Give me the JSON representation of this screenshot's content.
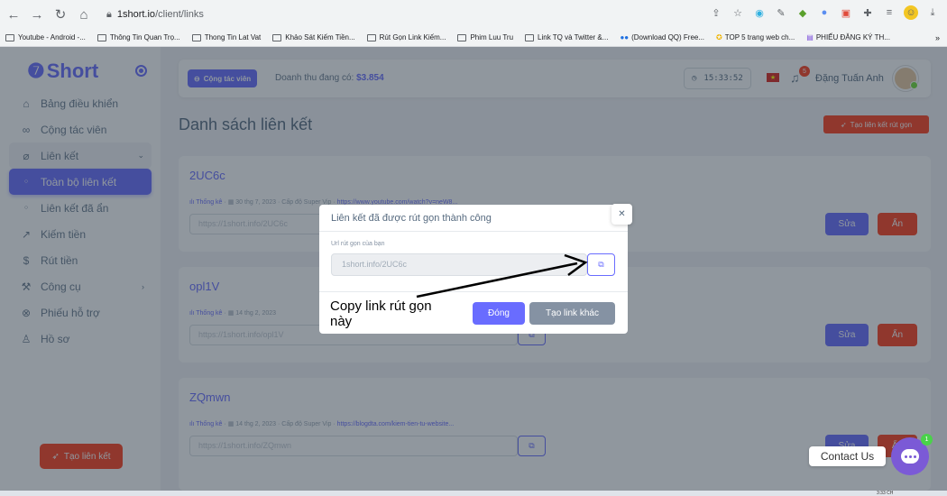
{
  "browser": {
    "url_host": "1short.io",
    "url_path": "/client/links",
    "bookmarks": [
      "Youtube - Android -...",
      "Thông Tin Quan Trọ...",
      "Thong Tin Lat Vat",
      "Khảo Sát Kiếm Tiền...",
      "Rút Gọn Link Kiếm...",
      "Phim Luu Tru",
      "Link TQ và Twitter &...",
      "(Download QQ) Free...",
      "TOP 5 trang web ch...",
      "PHIẾU ĐĂNG KÝ TH..."
    ],
    "more": "»"
  },
  "sidebar": {
    "logo": "Short",
    "items": [
      {
        "label": "Bảng điều khiển",
        "icon": "home-icon",
        "glyph": "⌂"
      },
      {
        "label": "Cộng tác viên",
        "icon": "link-icon",
        "glyph": "∞"
      },
      {
        "label": "Liên kết",
        "icon": "chain-icon",
        "glyph": "⌀"
      },
      {
        "label": "Toàn bộ liên kết",
        "icon": "dot-icon",
        "glyph": "○"
      },
      {
        "label": "Liên kết đã ẩn",
        "icon": "dot-icon",
        "glyph": "○"
      },
      {
        "label": "Kiếm tiền",
        "icon": "trend-icon",
        "glyph": "↗"
      },
      {
        "label": "Rút tiền",
        "icon": "dollar-icon",
        "glyph": "$"
      },
      {
        "label": "Công cụ",
        "icon": "tool-icon",
        "glyph": "⚒"
      },
      {
        "label": "Phiếu hỗ trợ",
        "icon": "lifebuoy-icon",
        "glyph": "⊗"
      },
      {
        "label": "Hồ sơ",
        "icon": "user-icon",
        "glyph": "♙"
      }
    ],
    "create_button": "Tạo liên kết"
  },
  "topbar": {
    "affiliate_button": "Cộng tác viên",
    "revenue_label": "Doanh thu đang có:",
    "revenue_value": "$3.854",
    "time": "15:33:52",
    "notification_count": "5",
    "user_name": "Đặng Tuấn Anh"
  },
  "page": {
    "title": "Danh sách liên kết",
    "create_button": "Tạo liên kết rút gọn"
  },
  "links": [
    {
      "name": "2UC6c",
      "stats": "Thống kê",
      "date": "30 thg 7, 2023",
      "level": "Cấp độ Super Vip",
      "target": "https://www.youtube.com/watch?v=neW8...",
      "short_url": "https://1short.info/2UC6c",
      "edit": "Sửa",
      "hide": "Ẩn"
    },
    {
      "name": "opl1V",
      "stats": "Thống kê",
      "date": "14 thg 2, 2023",
      "level": "",
      "target": "",
      "short_url": "https://1short.info/opl1V",
      "edit": "Sửa",
      "hide": "Ẩn"
    },
    {
      "name": "ZQmwn",
      "stats": "Thống kê",
      "date": "14 thg 2, 2023",
      "level": "Cấp độ Super Vip",
      "target": "https://blogdta.com/kiem-tien-tu-website...",
      "short_url": "https://1short.info/ZQmwn",
      "edit": "Sửa",
      "hide": "Ẩn"
    }
  ],
  "modal": {
    "title": "Liên kết đã được rút gọn thành công",
    "label": "Url rút gọn của bạn",
    "value": "1short.info/2UC6c",
    "close_button": "Đóng",
    "new_link_button": "Tạo link khác",
    "annotation": "Copy link rút gọn này"
  },
  "contact": {
    "label": "Contact Us",
    "badge": "1"
  },
  "taskbar": {
    "time": "3:33 CH"
  },
  "colors": {
    "primary": "#696cff",
    "danger": "#ff3e1d",
    "secondary": "#8592a3"
  }
}
